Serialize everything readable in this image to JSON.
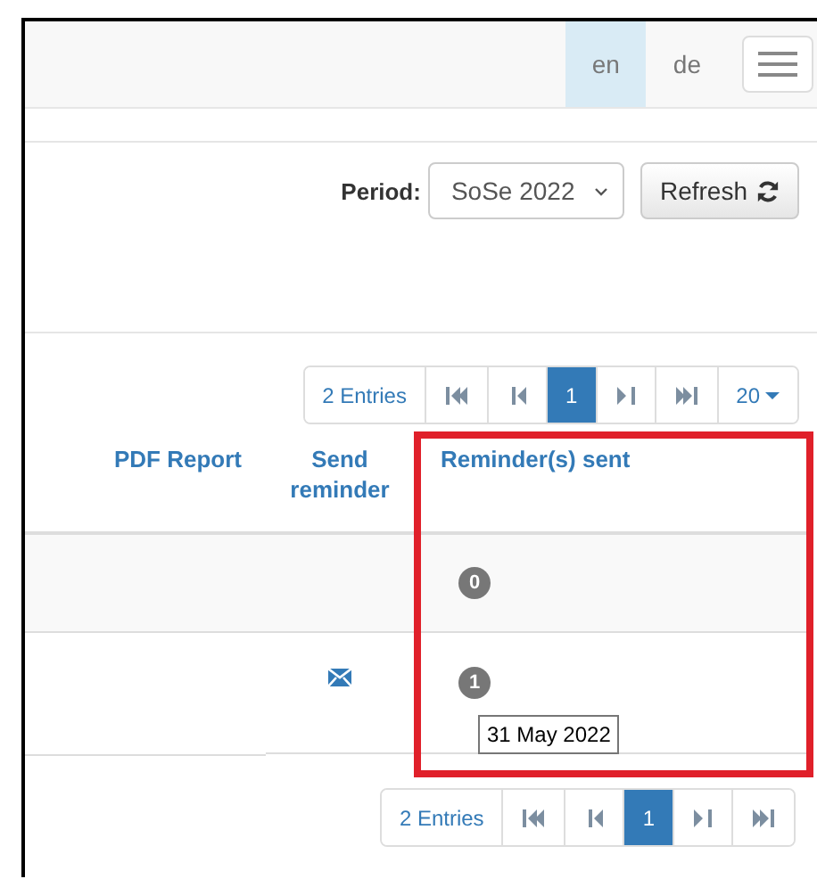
{
  "navbar": {
    "languages": [
      {
        "label": "en",
        "selected": true
      },
      {
        "label": "de",
        "selected": false
      }
    ]
  },
  "filter": {
    "label": "Period:",
    "value": "SoSe 2022",
    "button": "Refresh"
  },
  "pagination_top": {
    "entries": "2 Entries",
    "pages": [
      {
        "label": "1",
        "selected": true
      }
    ],
    "page_size": "20"
  },
  "table": {
    "columns": [
      {
        "label": "PDF Report",
        "highlighted": false
      },
      {
        "label": "Send reminder",
        "highlighted": false
      },
      {
        "label": "Reminder(s) sent",
        "highlighted": true
      }
    ],
    "rows": [
      {
        "can_send": false,
        "reminders_sent": "0"
      },
      {
        "can_send": true,
        "reminders_sent": "1",
        "tooltip": "31 May 2022"
      }
    ]
  },
  "pagination_bottom": {
    "entries": "2 Entries",
    "pages": [
      {
        "label": "1",
        "selected": true
      }
    ]
  }
}
